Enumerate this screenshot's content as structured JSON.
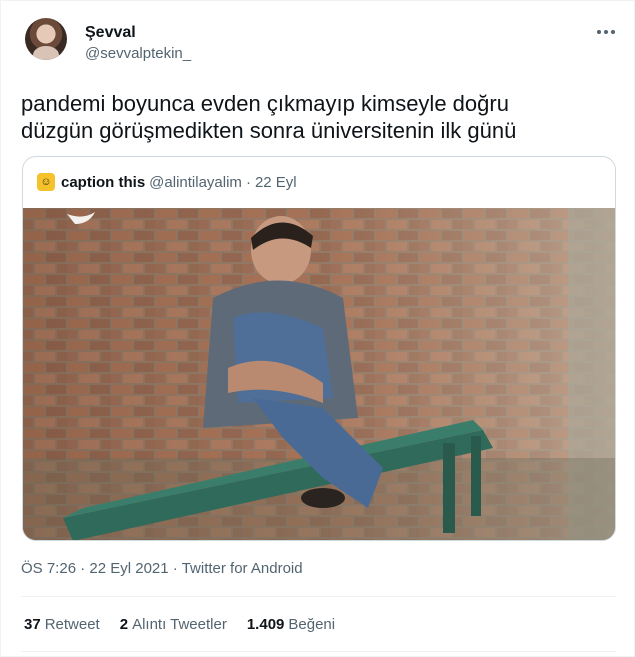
{
  "author": {
    "display_name": "Şevval",
    "handle": "@sevvalptekin_"
  },
  "tweet": {
    "lines": [
      "pandemi boyunca evden çıkmayıp kimseyle doğru",
      "düzgün görüşmedikten sonra üniversitenin ilk günü"
    ]
  },
  "quoted": {
    "display_name": "caption this",
    "handle": "@alintilayalim",
    "separator": "·",
    "date": "22 Eyl",
    "avatar_icon": "caption-this-logo-icon",
    "image": "man-sitting-on-green-bench-by-brick-wall"
  },
  "meta": {
    "time": "ÖS 7:26",
    "sep1": "·",
    "date": "22 Eyl 2021",
    "sep2": "·",
    "source": "Twitter for Android"
  },
  "stats": {
    "retweets_count": "37",
    "retweets_label": "Retweet",
    "quotes_count": "2",
    "quotes_label": "Alıntı Tweetler",
    "likes_count": "1.409",
    "likes_label": "Beğeni"
  },
  "colors": {
    "text_primary": "#0f1419",
    "text_secondary": "#536471",
    "border": "#cfd9de",
    "divider": "#eff3f4"
  }
}
